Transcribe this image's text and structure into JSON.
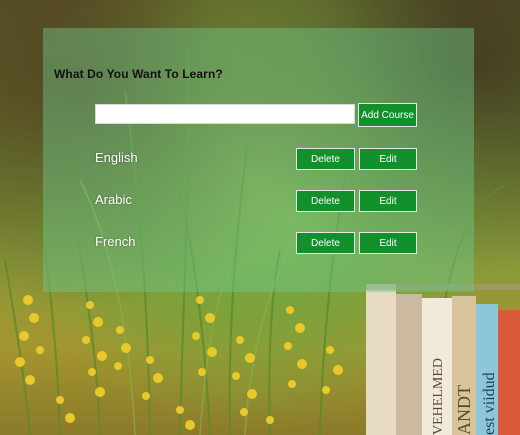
{
  "header": {
    "title": "What Do You Want To Learn?"
  },
  "add_form": {
    "input_value": "",
    "input_placeholder": "",
    "add_button_label": "Add Course"
  },
  "courses": [
    {
      "name": "English",
      "delete_label": "Delete",
      "edit_label": "Edit"
    },
    {
      "name": "Arabic",
      "delete_label": "Delete",
      "edit_label": "Edit"
    },
    {
      "name": "French",
      "delete_label": "Delete",
      "edit_label": "Edit"
    }
  ],
  "colors": {
    "button_green": "#12902b",
    "panel_overlay": "rgba(110,200,140,0.45)",
    "button_text": "#ffffff"
  },
  "background": {
    "book_spine_texts": [
      "VEHELMED",
      "ANDT",
      "est viidud"
    ]
  }
}
